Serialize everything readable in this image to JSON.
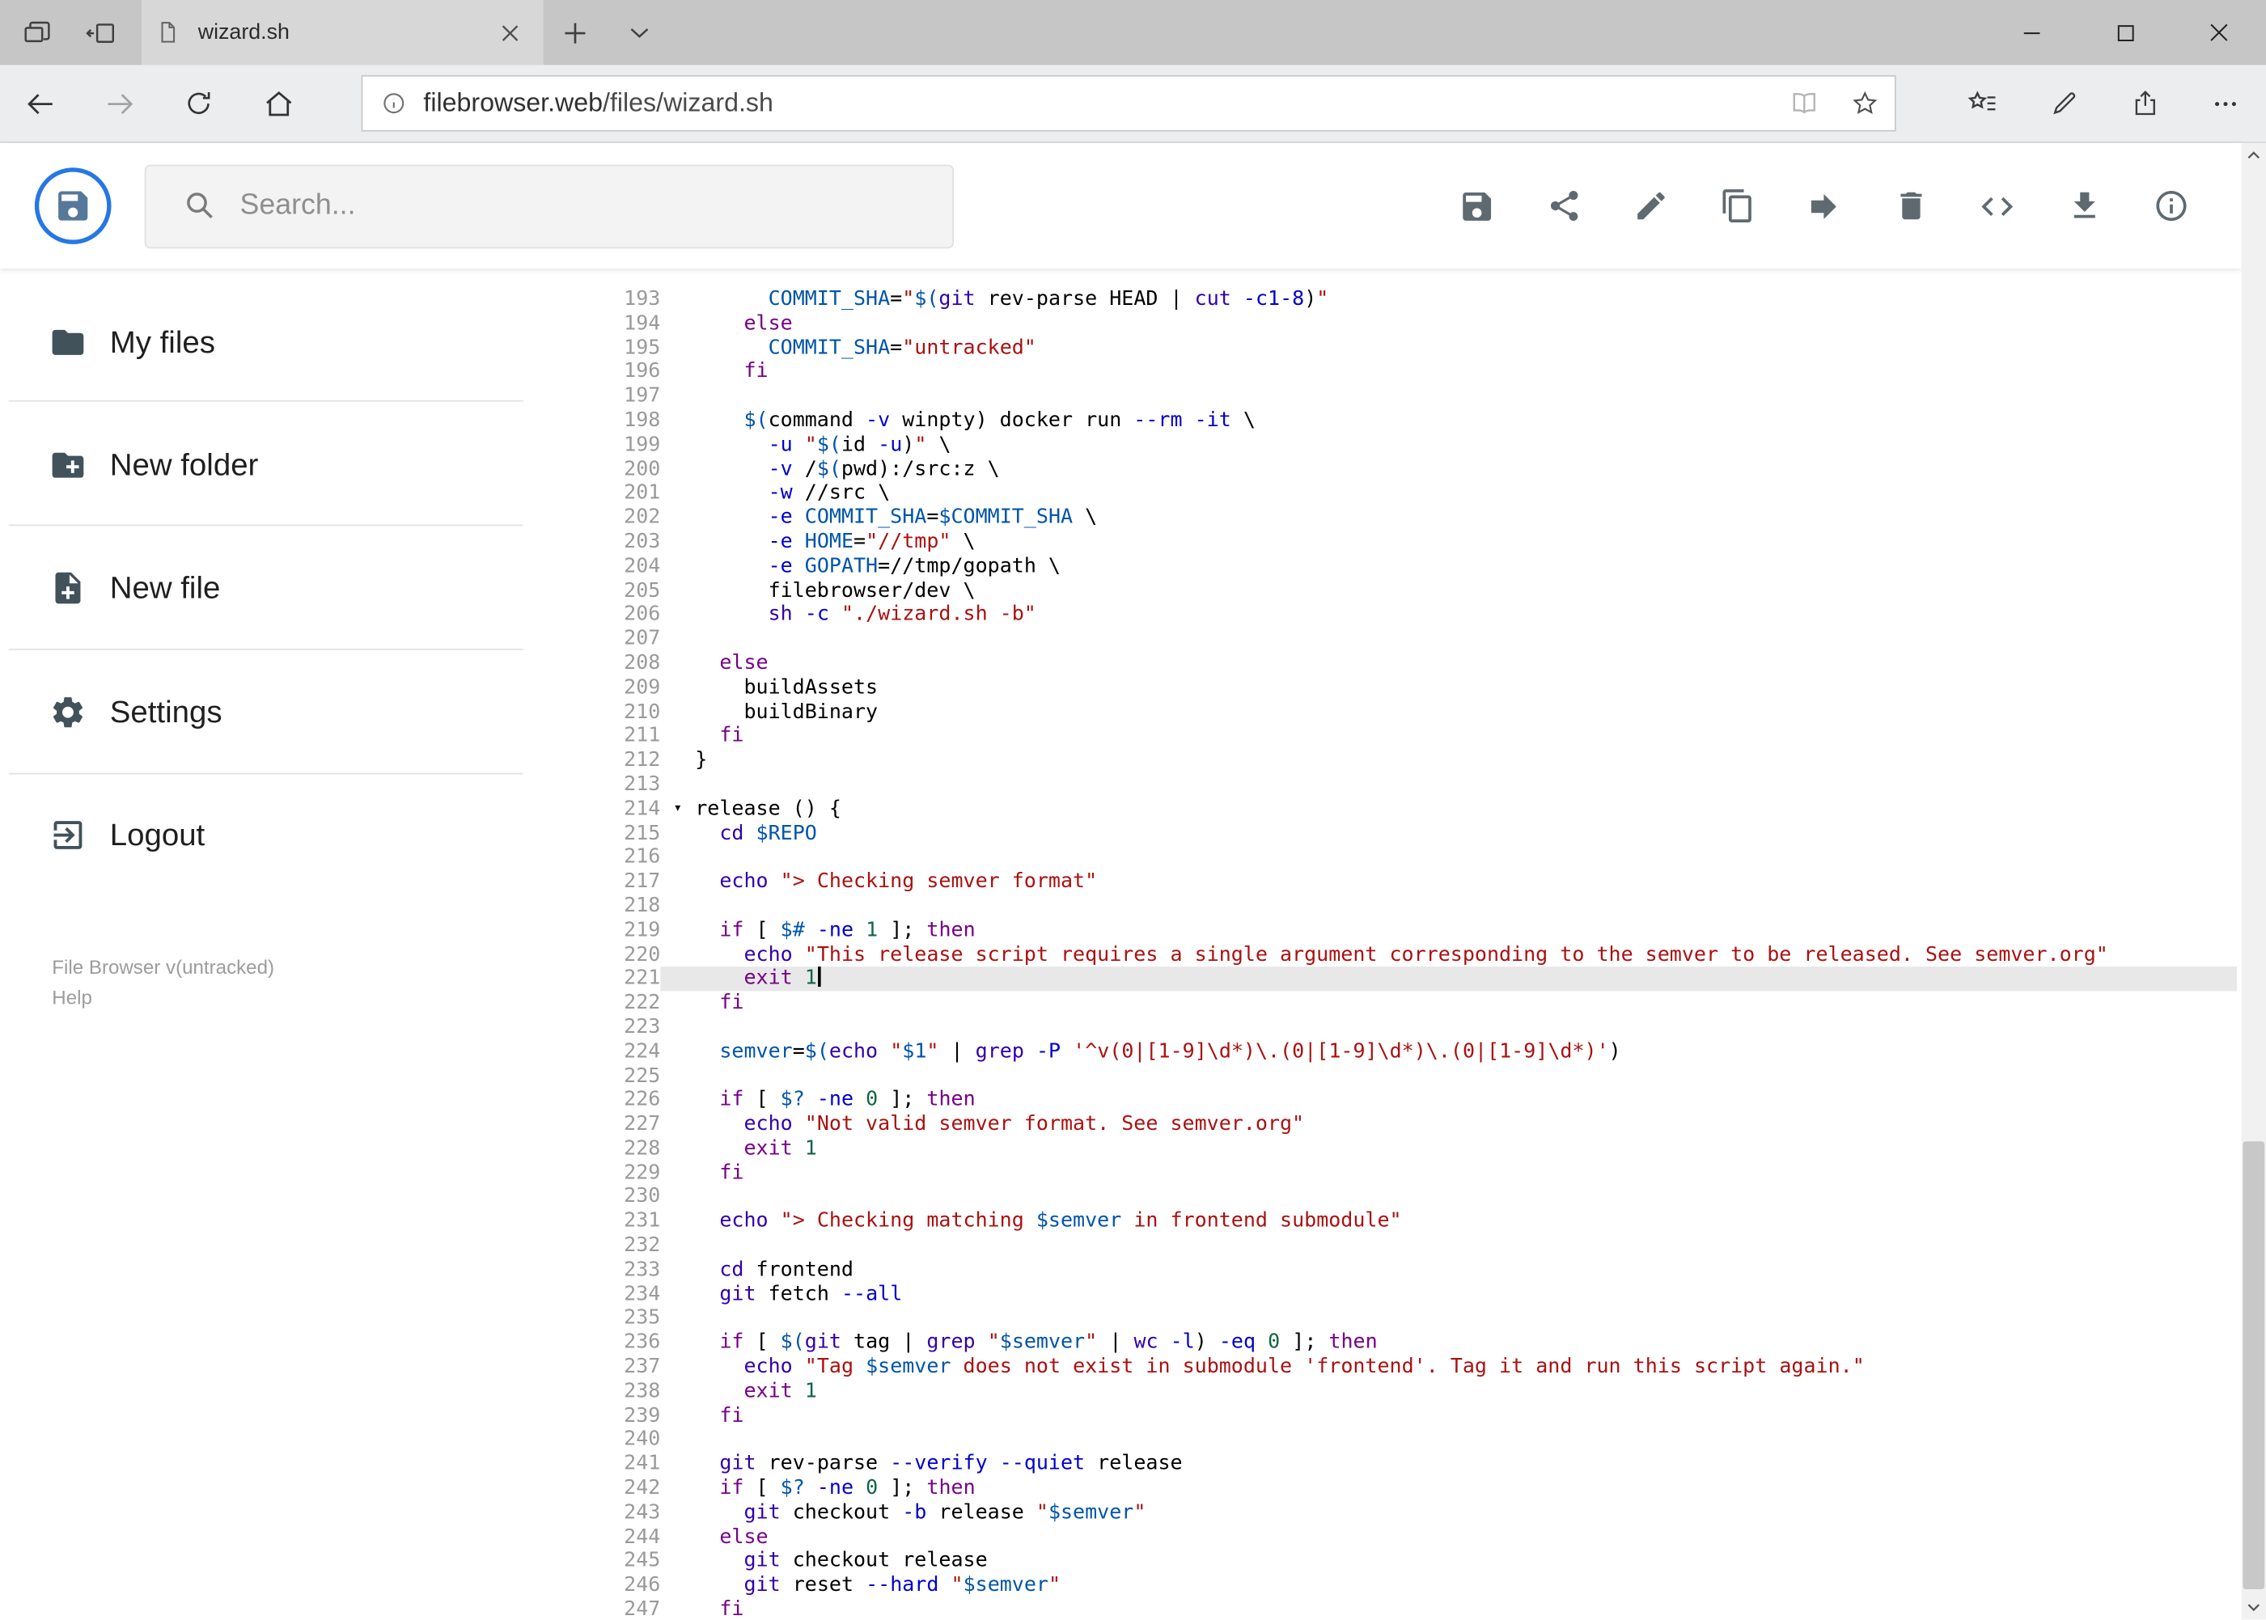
{
  "palette": {
    "accent_blue": "#2577e6",
    "active_line_bg": "#e8e8e8",
    "icon_gray": "#5f6a70"
  },
  "browser": {
    "tab": {
      "title": "wizard.sh"
    },
    "address": {
      "domain": "filebrowser.web",
      "path": "/files/wizard.sh"
    }
  },
  "app": {
    "search": {
      "placeholder": "Search..."
    },
    "sidebar": {
      "items": [
        {
          "label": "My files"
        },
        {
          "label": "New folder"
        },
        {
          "label": "New file"
        },
        {
          "label": "Settings"
        },
        {
          "label": "Logout"
        }
      ],
      "version": "File Browser v(untracked)",
      "help": "Help"
    }
  },
  "editor": {
    "first_line": 193,
    "active_line": 221,
    "cursor_line": 221,
    "fold_line": 214,
    "token_colors": {
      "p": "#000000",
      "k": "#770088",
      "b": "#3300aa",
      "v": "#0055aa",
      "d": "#0055aa",
      "s": "#aa1111",
      "n": "#116644",
      "a": "#0000cc"
    },
    "lines": [
      {
        "n": 193,
        "t": [
          [
            "p",
            "      "
          ],
          [
            "d",
            "COMMIT_SHA"
          ],
          [
            "p",
            "="
          ],
          [
            "s",
            "\""
          ],
          [
            "v",
            "$("
          ],
          [
            "b",
            "git"
          ],
          [
            "p",
            " rev-parse HEAD | "
          ],
          [
            "b",
            "cut"
          ],
          [
            "p",
            " "
          ],
          [
            "a",
            "-c1-8"
          ],
          [
            "p",
            ")"
          ],
          [
            "s",
            "\""
          ]
        ]
      },
      {
        "n": 194,
        "t": [
          [
            "p",
            "    "
          ],
          [
            "k",
            "else"
          ]
        ]
      },
      {
        "n": 195,
        "t": [
          [
            "p",
            "      "
          ],
          [
            "d",
            "COMMIT_SHA"
          ],
          [
            "p",
            "="
          ],
          [
            "s",
            "\"untracked\""
          ]
        ]
      },
      {
        "n": 196,
        "t": [
          [
            "p",
            "    "
          ],
          [
            "k",
            "fi"
          ]
        ]
      },
      {
        "n": 197,
        "t": []
      },
      {
        "n": 198,
        "t": [
          [
            "p",
            "    "
          ],
          [
            "v",
            "$("
          ],
          [
            "p",
            "command "
          ],
          [
            "a",
            "-v"
          ],
          [
            "p",
            " winpty) docker run "
          ],
          [
            "a",
            "--rm"
          ],
          [
            "p",
            " "
          ],
          [
            "a",
            "-it"
          ],
          [
            "p",
            " \\"
          ]
        ]
      },
      {
        "n": 199,
        "t": [
          [
            "p",
            "      "
          ],
          [
            "a",
            "-u"
          ],
          [
            "p",
            " "
          ],
          [
            "s",
            "\""
          ],
          [
            "v",
            "$("
          ],
          [
            "p",
            "id "
          ],
          [
            "a",
            "-u"
          ],
          [
            "p",
            ")"
          ],
          [
            "s",
            "\""
          ],
          [
            "p",
            " \\"
          ]
        ]
      },
      {
        "n": 200,
        "t": [
          [
            "p",
            "      "
          ],
          [
            "a",
            "-v"
          ],
          [
            "p",
            " /"
          ],
          [
            "v",
            "$("
          ],
          [
            "p",
            "pwd):/src:z \\"
          ]
        ]
      },
      {
        "n": 201,
        "t": [
          [
            "p",
            "      "
          ],
          [
            "a",
            "-w"
          ],
          [
            "p",
            " //src \\"
          ]
        ]
      },
      {
        "n": 202,
        "t": [
          [
            "p",
            "      "
          ],
          [
            "a",
            "-e"
          ],
          [
            "p",
            " "
          ],
          [
            "d",
            "COMMIT_SHA"
          ],
          [
            "p",
            "="
          ],
          [
            "v",
            "$COMMIT_SHA"
          ],
          [
            "p",
            " \\"
          ]
        ]
      },
      {
        "n": 203,
        "t": [
          [
            "p",
            "      "
          ],
          [
            "a",
            "-e"
          ],
          [
            "p",
            " "
          ],
          [
            "d",
            "HOME"
          ],
          [
            "p",
            "="
          ],
          [
            "s",
            "\"//tmp\""
          ],
          [
            "p",
            " \\"
          ]
        ]
      },
      {
        "n": 204,
        "t": [
          [
            "p",
            "      "
          ],
          [
            "a",
            "-e"
          ],
          [
            "p",
            " "
          ],
          [
            "d",
            "GOPATH"
          ],
          [
            "p",
            "="
          ],
          [
            "p",
            "//tmp/gopath \\"
          ]
        ]
      },
      {
        "n": 205,
        "t": [
          [
            "p",
            "      filebrowser/dev \\"
          ]
        ]
      },
      {
        "n": 206,
        "t": [
          [
            "p",
            "      "
          ],
          [
            "b",
            "sh"
          ],
          [
            "p",
            " "
          ],
          [
            "a",
            "-c"
          ],
          [
            "p",
            " "
          ],
          [
            "s",
            "\"./wizard.sh -b\""
          ]
        ]
      },
      {
        "n": 207,
        "t": []
      },
      {
        "n": 208,
        "t": [
          [
            "p",
            "  "
          ],
          [
            "k",
            "else"
          ]
        ]
      },
      {
        "n": 209,
        "t": [
          [
            "p",
            "    buildAssets"
          ]
        ]
      },
      {
        "n": 210,
        "t": [
          [
            "p",
            "    buildBinary"
          ]
        ]
      },
      {
        "n": 211,
        "t": [
          [
            "p",
            "  "
          ],
          [
            "k",
            "fi"
          ]
        ]
      },
      {
        "n": 212,
        "t": [
          [
            "p",
            "}"
          ]
        ]
      },
      {
        "n": 213,
        "t": []
      },
      {
        "n": 214,
        "t": [
          [
            "p",
            "release () {"
          ]
        ]
      },
      {
        "n": 215,
        "t": [
          [
            "p",
            "  "
          ],
          [
            "b",
            "cd"
          ],
          [
            "p",
            " "
          ],
          [
            "v",
            "$REPO"
          ]
        ]
      },
      {
        "n": 216,
        "t": []
      },
      {
        "n": 217,
        "t": [
          [
            "p",
            "  "
          ],
          [
            "b",
            "echo"
          ],
          [
            "p",
            " "
          ],
          [
            "s",
            "\"> Checking semver format\""
          ]
        ]
      },
      {
        "n": 218,
        "t": []
      },
      {
        "n": 219,
        "t": [
          [
            "p",
            "  "
          ],
          [
            "k",
            "if"
          ],
          [
            "p",
            " [ "
          ],
          [
            "v",
            "$#"
          ],
          [
            "p",
            " "
          ],
          [
            "a",
            "-ne"
          ],
          [
            "p",
            " "
          ],
          [
            "n",
            "1"
          ],
          [
            "p",
            " ]; "
          ],
          [
            "k",
            "then"
          ]
        ]
      },
      {
        "n": 220,
        "t": [
          [
            "p",
            "    "
          ],
          [
            "b",
            "echo"
          ],
          [
            "p",
            " "
          ],
          [
            "s",
            "\"This release script requires a single argument corresponding to the semver to be released. See semver.org\""
          ]
        ]
      },
      {
        "n": 221,
        "t": [
          [
            "p",
            "    "
          ],
          [
            "k",
            "exit"
          ],
          [
            "p",
            " "
          ],
          [
            "n",
            "1"
          ]
        ]
      },
      {
        "n": 222,
        "t": [
          [
            "p",
            "  "
          ],
          [
            "k",
            "fi"
          ]
        ]
      },
      {
        "n": 223,
        "t": []
      },
      {
        "n": 224,
        "t": [
          [
            "p",
            "  "
          ],
          [
            "d",
            "semver"
          ],
          [
            "p",
            "="
          ],
          [
            "v",
            "$("
          ],
          [
            "b",
            "echo"
          ],
          [
            "p",
            " "
          ],
          [
            "s",
            "\""
          ],
          [
            "v",
            "$1"
          ],
          [
            "s",
            "\""
          ],
          [
            "p",
            " | "
          ],
          [
            "b",
            "grep"
          ],
          [
            "p",
            " "
          ],
          [
            "a",
            "-P"
          ],
          [
            "p",
            " "
          ],
          [
            "s",
            "'^v(0|[1-9]\\d*)\\.(0|[1-9]\\d*)\\.(0|[1-9]\\d*)'"
          ],
          [
            "p",
            ")"
          ]
        ]
      },
      {
        "n": 225,
        "t": []
      },
      {
        "n": 226,
        "t": [
          [
            "p",
            "  "
          ],
          [
            "k",
            "if"
          ],
          [
            "p",
            " [ "
          ],
          [
            "v",
            "$?"
          ],
          [
            "p",
            " "
          ],
          [
            "a",
            "-ne"
          ],
          [
            "p",
            " "
          ],
          [
            "n",
            "0"
          ],
          [
            "p",
            " ]; "
          ],
          [
            "k",
            "then"
          ]
        ]
      },
      {
        "n": 227,
        "t": [
          [
            "p",
            "    "
          ],
          [
            "b",
            "echo"
          ],
          [
            "p",
            " "
          ],
          [
            "s",
            "\"Not valid semver format. See semver.org\""
          ]
        ]
      },
      {
        "n": 228,
        "t": [
          [
            "p",
            "    "
          ],
          [
            "k",
            "exit"
          ],
          [
            "p",
            " "
          ],
          [
            "n",
            "1"
          ]
        ]
      },
      {
        "n": 229,
        "t": [
          [
            "p",
            "  "
          ],
          [
            "k",
            "fi"
          ]
        ]
      },
      {
        "n": 230,
        "t": []
      },
      {
        "n": 231,
        "t": [
          [
            "p",
            "  "
          ],
          [
            "b",
            "echo"
          ],
          [
            "p",
            " "
          ],
          [
            "s",
            "\"> Checking matching "
          ],
          [
            "v",
            "$semver"
          ],
          [
            "s",
            " in frontend submodule\""
          ]
        ]
      },
      {
        "n": 232,
        "t": []
      },
      {
        "n": 233,
        "t": [
          [
            "p",
            "  "
          ],
          [
            "b",
            "cd"
          ],
          [
            "p",
            " frontend"
          ]
        ]
      },
      {
        "n": 234,
        "t": [
          [
            "p",
            "  "
          ],
          [
            "b",
            "git"
          ],
          [
            "p",
            " fetch "
          ],
          [
            "a",
            "--all"
          ]
        ]
      },
      {
        "n": 235,
        "t": []
      },
      {
        "n": 236,
        "t": [
          [
            "p",
            "  "
          ],
          [
            "k",
            "if"
          ],
          [
            "p",
            " [ "
          ],
          [
            "v",
            "$("
          ],
          [
            "b",
            "git"
          ],
          [
            "p",
            " tag | "
          ],
          [
            "b",
            "grep"
          ],
          [
            "p",
            " "
          ],
          [
            "s",
            "\""
          ],
          [
            "v",
            "$semver"
          ],
          [
            "s",
            "\""
          ],
          [
            "p",
            " | "
          ],
          [
            "b",
            "wc"
          ],
          [
            "p",
            " "
          ],
          [
            "a",
            "-l"
          ],
          [
            "p",
            ") "
          ],
          [
            "a",
            "-eq"
          ],
          [
            "p",
            " "
          ],
          [
            "n",
            "0"
          ],
          [
            "p",
            " ]; "
          ],
          [
            "k",
            "then"
          ]
        ]
      },
      {
        "n": 237,
        "t": [
          [
            "p",
            "    "
          ],
          [
            "b",
            "echo"
          ],
          [
            "p",
            " "
          ],
          [
            "s",
            "\"Tag "
          ],
          [
            "v",
            "$semver"
          ],
          [
            "s",
            " does not exist in submodule 'frontend'. Tag it and run this script again.\""
          ]
        ]
      },
      {
        "n": 238,
        "t": [
          [
            "p",
            "    "
          ],
          [
            "k",
            "exit"
          ],
          [
            "p",
            " "
          ],
          [
            "n",
            "1"
          ]
        ]
      },
      {
        "n": 239,
        "t": [
          [
            "p",
            "  "
          ],
          [
            "k",
            "fi"
          ]
        ]
      },
      {
        "n": 240,
        "t": []
      },
      {
        "n": 241,
        "t": [
          [
            "p",
            "  "
          ],
          [
            "b",
            "git"
          ],
          [
            "p",
            " rev-parse "
          ],
          [
            "a",
            "--verify"
          ],
          [
            "p",
            " "
          ],
          [
            "a",
            "--quiet"
          ],
          [
            "p",
            " release"
          ]
        ]
      },
      {
        "n": 242,
        "t": [
          [
            "p",
            "  "
          ],
          [
            "k",
            "if"
          ],
          [
            "p",
            " [ "
          ],
          [
            "v",
            "$?"
          ],
          [
            "p",
            " "
          ],
          [
            "a",
            "-ne"
          ],
          [
            "p",
            " "
          ],
          [
            "n",
            "0"
          ],
          [
            "p",
            " ]; "
          ],
          [
            "k",
            "then"
          ]
        ]
      },
      {
        "n": 243,
        "t": [
          [
            "p",
            "    "
          ],
          [
            "b",
            "git"
          ],
          [
            "p",
            " checkout "
          ],
          [
            "a",
            "-b"
          ],
          [
            "p",
            " release "
          ],
          [
            "s",
            "\""
          ],
          [
            "v",
            "$semver"
          ],
          [
            "s",
            "\""
          ]
        ]
      },
      {
        "n": 244,
        "t": [
          [
            "p",
            "  "
          ],
          [
            "k",
            "else"
          ]
        ]
      },
      {
        "n": 245,
        "t": [
          [
            "p",
            "    "
          ],
          [
            "b",
            "git"
          ],
          [
            "p",
            " checkout release"
          ]
        ]
      },
      {
        "n": 246,
        "t": [
          [
            "p",
            "    "
          ],
          [
            "b",
            "git"
          ],
          [
            "p",
            " reset "
          ],
          [
            "a",
            "--hard"
          ],
          [
            "p",
            " "
          ],
          [
            "s",
            "\""
          ],
          [
            "v",
            "$semver"
          ],
          [
            "s",
            "\""
          ]
        ]
      },
      {
        "n": 247,
        "t": [
          [
            "p",
            "  "
          ],
          [
            "k",
            "fi"
          ]
        ]
      }
    ]
  }
}
